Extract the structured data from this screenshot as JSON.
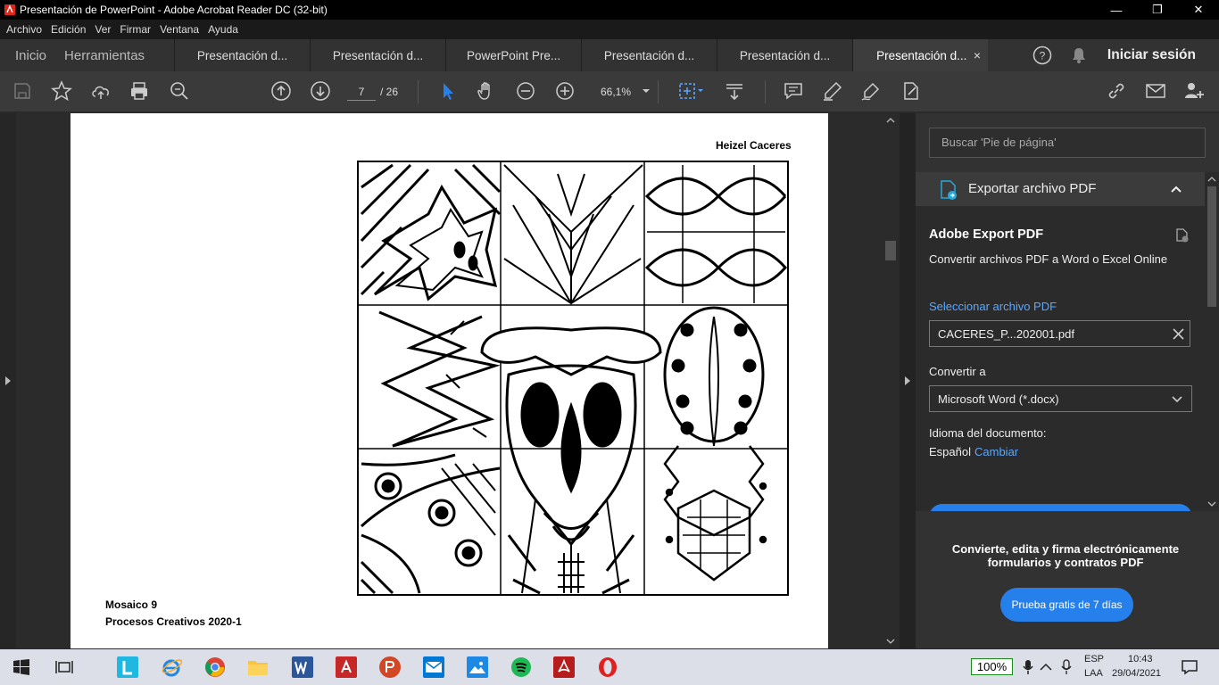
{
  "window": {
    "title": "Presentación de PowerPoint - Adobe Acrobat Reader DC (32-bit)",
    "min": "—",
    "restore": "❐",
    "close": "✕"
  },
  "menu": {
    "items": [
      "Archivo",
      "Edición",
      "Ver",
      "Firmar",
      "Ventana",
      "Ayuda"
    ]
  },
  "tabs": {
    "home": "Inicio",
    "tools": "Herramientas",
    "documents": [
      "Presentación d...",
      "Presentación d...",
      "PowerPoint Pre...",
      "Presentación d...",
      "Presentación d...",
      "Presentación d..."
    ],
    "active_close": "×",
    "help": "?",
    "signin": "Iniciar sesión"
  },
  "toolbar": {
    "page_current": "7",
    "page_total": "/ 26",
    "zoom": "66,1%"
  },
  "document": {
    "author": "Heizel Caceres",
    "caption1": "Mosaico 9",
    "caption2": "Procesos Creativos 2020-1"
  },
  "right_panel": {
    "search_placeholder": "Buscar 'Pie de página'",
    "section_title": "Exportar archivo PDF",
    "heading": "Adobe Export PDF",
    "description": "Convertir archivos PDF a Word o Excel Online",
    "select_link": "Seleccionar archivo PDF",
    "file_name": "CACERES_P...202001.pdf",
    "convert_label": "Convertir a",
    "convert_value": "Microsoft Word (*.docx)",
    "language_label": "Idioma del documento:",
    "language_value": "Español",
    "change_link": "Cambiar",
    "promo_text": "Convierte, edita y firma electrónicamente formularios y contratos PDF",
    "trial_button": "Prueba gratis de 7 días"
  },
  "taskbar": {
    "battery": "100%",
    "lang1": "ESP",
    "lang2": "LAA",
    "time": "10:43",
    "date": "29/04/2021"
  },
  "colors": {
    "accent_blue": "#2680eb",
    "link_blue": "#5ba7ff",
    "acrobat_red": "#e0261b"
  }
}
